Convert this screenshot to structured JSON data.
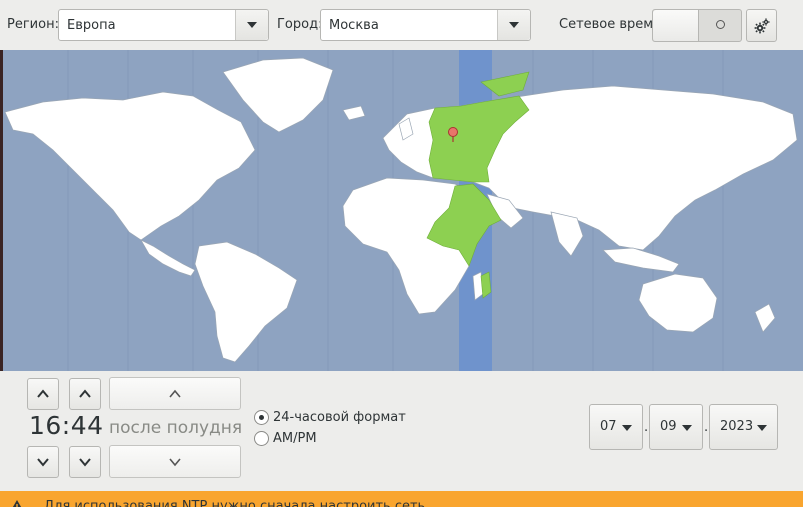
{
  "header": {
    "region_label": "Регион:",
    "region_value": "Европа",
    "city_label": "Город:",
    "city_value": "Москва",
    "network_time_label": "Сетевое время",
    "network_time_enabled": false
  },
  "map": {
    "selected_city": "Москва",
    "timezone_highlight_color": "#6f93cc",
    "selected_zone_color": "#8dd051",
    "land_color": "#ffffff",
    "ocean_color": "#8ea3c1"
  },
  "time": {
    "display": "16:44",
    "period": "после полудня"
  },
  "format": {
    "option_24h": "24-часовой формат",
    "option_ampm": "AM/PM",
    "selected": "24h"
  },
  "date": {
    "day": "07",
    "month": "09",
    "year": "2023",
    "separator": "."
  },
  "warning": {
    "text": "Для использования NTP нужно сначала настроить сеть",
    "color": "#f9a52f"
  }
}
